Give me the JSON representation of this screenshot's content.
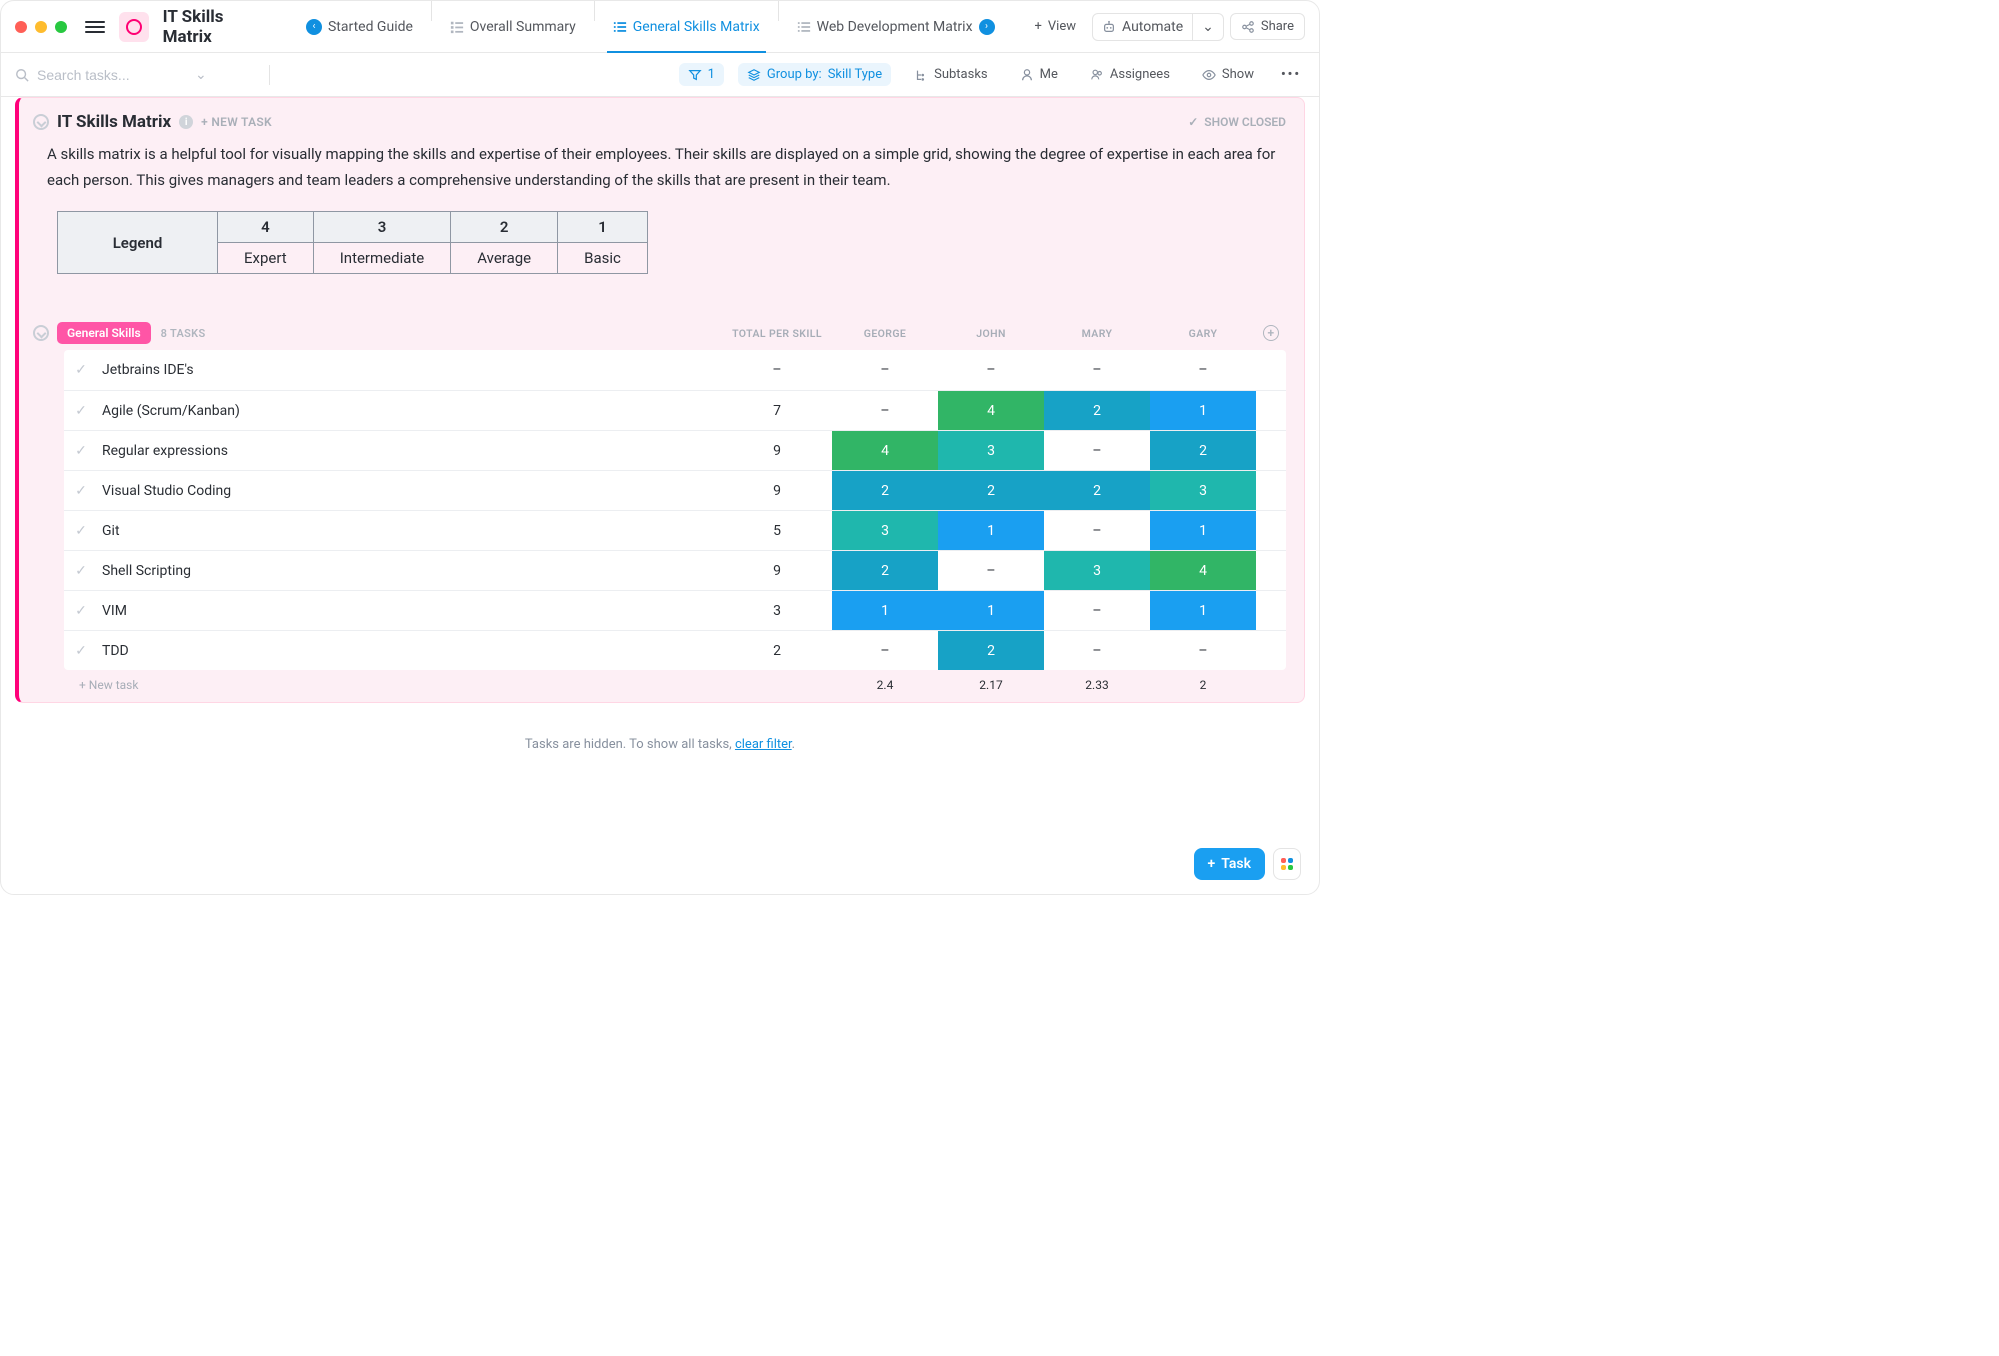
{
  "header": {
    "page_title": "IT Skills Matrix",
    "tabs": [
      {
        "label": "Started Guide",
        "nav": "left"
      },
      {
        "label": "Overall Summary"
      },
      {
        "label": "General Skills Matrix",
        "active": true
      },
      {
        "label": "Web Development Matrix",
        "nav": "right"
      }
    ],
    "view_button": "View",
    "automate_button": "Automate",
    "share_button": "Share"
  },
  "toolbar": {
    "search_placeholder": "Search tasks...",
    "filter_count": "1",
    "group_label": "Group by:",
    "group_value": "Skill Type",
    "subtasks": "Subtasks",
    "me": "Me",
    "assignees": "Assignees",
    "show": "Show"
  },
  "panel": {
    "title": "IT Skills Matrix",
    "new_task": "+ NEW TASK",
    "show_closed": "SHOW CLOSED",
    "description": "A skills matrix is a helpful tool for visually mapping the skills and expertise of their employees. Their skills are displayed on a simple grid, showing the degree of expertise in each area for each person. This gives managers and team leaders a comprehensive understanding of the skills that are present in their team."
  },
  "legend": {
    "title": "Legend",
    "levels": [
      {
        "num": "4",
        "label": "Expert"
      },
      {
        "num": "3",
        "label": "Intermediate"
      },
      {
        "num": "2",
        "label": "Average"
      },
      {
        "num": "1",
        "label": "Basic"
      }
    ]
  },
  "section": {
    "name": "General Skills",
    "count": "8 TASKS",
    "columns": [
      "TOTAL PER SKILL",
      "GEORGE",
      "JOHN",
      "MARY",
      "GARY"
    ]
  },
  "rows": [
    {
      "name": "Jetbrains IDE's",
      "total": "–",
      "vals": [
        "–",
        "–",
        "–",
        "–"
      ]
    },
    {
      "name": "Agile (Scrum/Kanban)",
      "total": "7",
      "vals": [
        "–",
        "4",
        "2",
        "1"
      ]
    },
    {
      "name": "Regular expressions",
      "total": "9",
      "vals": [
        "4",
        "3",
        "–",
        "2"
      ]
    },
    {
      "name": "Visual Studio Coding",
      "total": "9",
      "vals": [
        "2",
        "2",
        "2",
        "3"
      ]
    },
    {
      "name": "Git",
      "total": "5",
      "vals": [
        "3",
        "1",
        "–",
        "1"
      ]
    },
    {
      "name": "Shell Scripting",
      "total": "9",
      "vals": [
        "2",
        "–",
        "3",
        "4"
      ]
    },
    {
      "name": "VIM",
      "total": "3",
      "vals": [
        "1",
        "1",
        "–",
        "1"
      ]
    },
    {
      "name": "TDD",
      "total": "2",
      "vals": [
        "–",
        "2",
        "–",
        "–"
      ]
    }
  ],
  "averages": [
    "2.4",
    "2.17",
    "2.33",
    "2"
  ],
  "new_task_row": "+ New task",
  "hidden_note": {
    "prefix": "Tasks are hidden. To show all tasks, ",
    "link": "clear filter",
    "suffix": "."
  },
  "fab": {
    "label": "Task"
  },
  "colors": {
    "1": "#1a9ff1",
    "2": "#17a2c6",
    "3": "#1fb7ad",
    "4": "#31b566"
  }
}
